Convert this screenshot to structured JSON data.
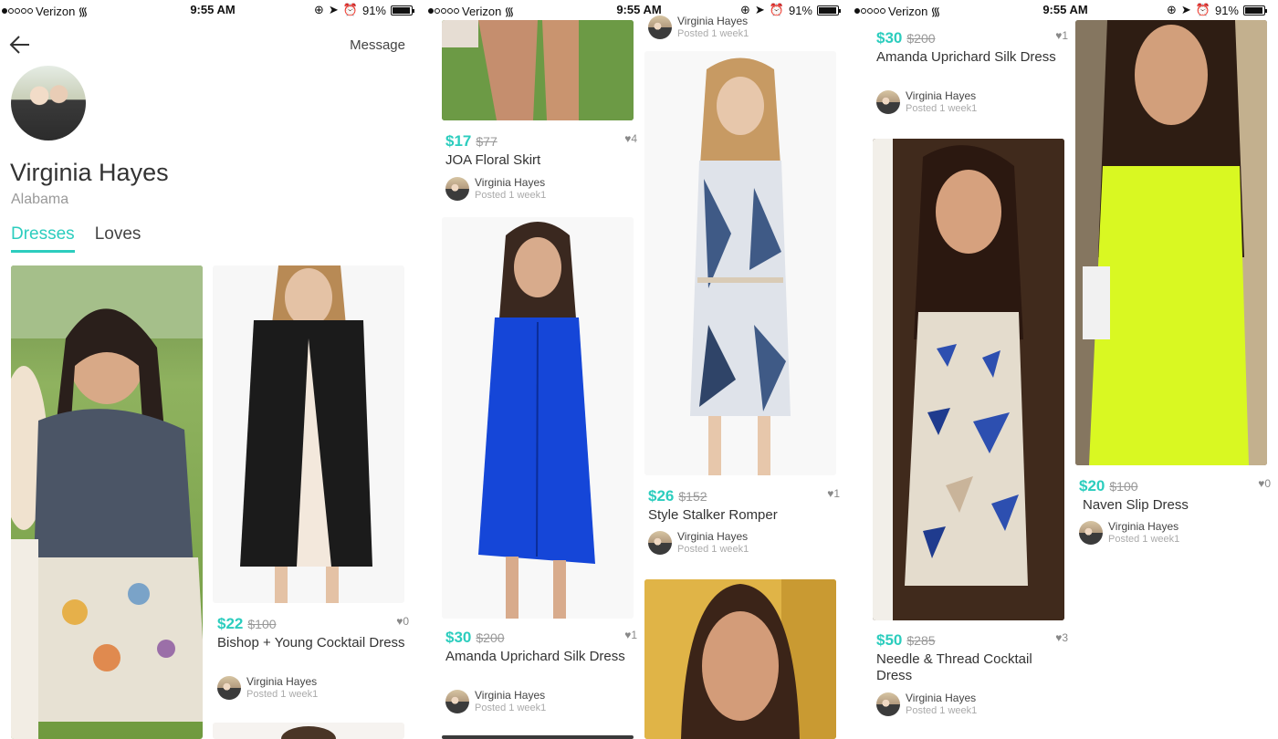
{
  "status": {
    "carrier": "Verizon",
    "time": "9:55 AM",
    "battery": "91%",
    "battery_level": 0.91
  },
  "profile": {
    "back_icon": "back-arrow-icon",
    "message_label": "Message",
    "name": "Virginia Hayes",
    "location": "Alabama",
    "tabs": [
      {
        "label": "Dresses",
        "active": true
      },
      {
        "label": "Loves",
        "active": false
      }
    ]
  },
  "listings": {
    "bishop": {
      "price": "$22",
      "original": "$100",
      "likes": "♥0",
      "title": "Bishop + Young Cocktail Dress",
      "seller": "Virginia Hayes",
      "posted": "Posted 1 week1"
    },
    "joa": {
      "price": "$17",
      "original": "$77",
      "likes": "♥4",
      "title": "JOA Floral Skirt",
      "seller": "Virginia Hayes",
      "posted": "Posted 1 week1"
    },
    "amanda1": {
      "price": "$30",
      "original": "$200",
      "likes": "♥1",
      "title": "Amanda Uprichard Silk Dress",
      "seller": "Virginia Hayes",
      "posted": "Posted 1 week1"
    },
    "top_cut": {
      "seller": "Virginia Hayes",
      "posted": "Posted 1 week1"
    },
    "stalker": {
      "price": "$26",
      "original": "$152",
      "likes": "♥1",
      "title": "Style Stalker Romper",
      "seller": "Virginia Hayes",
      "posted": "Posted 1 week1"
    },
    "amanda2": {
      "price": "$30",
      "original": "$200",
      "likes": "♥1",
      "title": "Amanda Uprichard Silk Dress",
      "seller": "Virginia Hayes",
      "posted": "Posted 1 week1"
    },
    "needle": {
      "price": "$50",
      "original": "$285",
      "likes": "♥3",
      "title": "Needle & Thread Cocktail Dress",
      "seller": "Virginia Hayes",
      "posted": "Posted 1 week1"
    },
    "naven": {
      "price": "$20",
      "original": "$100",
      "likes": "♥0",
      "title": "Naven Slip Dress",
      "seller": "Virginia Hayes",
      "posted": "Posted 1 week1"
    }
  }
}
